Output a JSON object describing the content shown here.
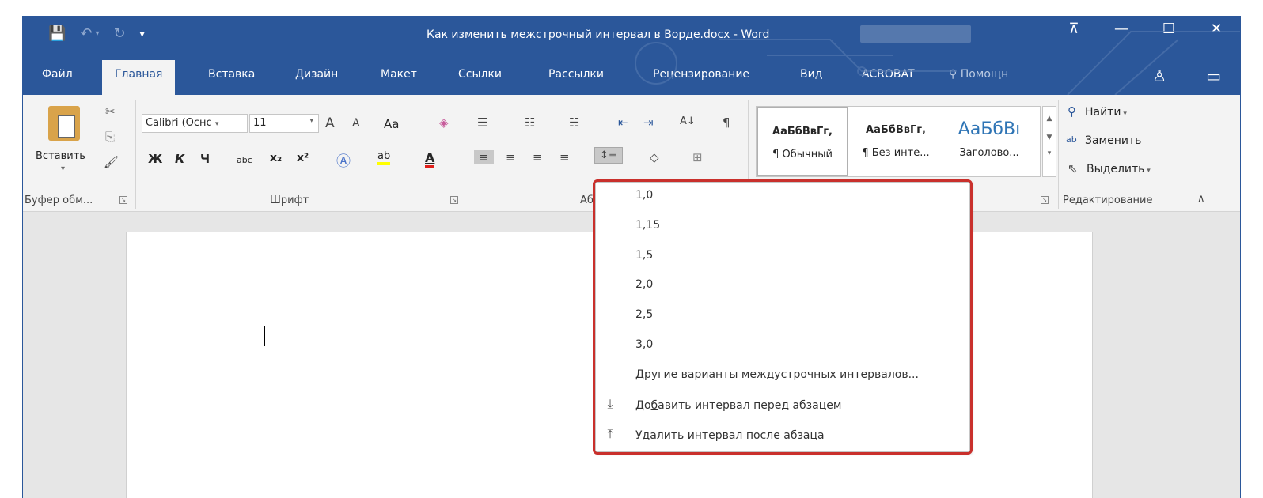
{
  "titlebar": {
    "title": "Как изменить межстрочный интервал в Ворде.docx - Word",
    "save_icon": "💾",
    "undo_icon": "↶",
    "undo_arrow": "▾",
    "redo_icon": "↻",
    "qat_more": "▾",
    "ribbon_display": "⊼",
    "minimize": "—",
    "maximize": "☐",
    "close": "✕"
  },
  "tabs": {
    "file": "Файл",
    "home": "Главная",
    "insert": "Вставка",
    "design": "Дизайн",
    "layout": "Макет",
    "references": "Ссылки",
    "mailings": "Рассылки",
    "review": "Рецензирование",
    "view": "Вид",
    "acrobat": "ACROBAT",
    "help": "♀ Помощн",
    "share_icon": "♙",
    "comment_icon": "▭"
  },
  "clipboard": {
    "paste": "Вставить",
    "paste_arrow": "▾",
    "cut_icon": "✂",
    "copy_icon": "⎘",
    "format_painter_icon": "🖌",
    "label": "Буфер обм..."
  },
  "font": {
    "font_name": "Calibri (Оснс",
    "font_size": "11",
    "grow": "A",
    "shrink": "A",
    "change_case": "Aa",
    "clear_formatting_icon": "◈",
    "bold": "Ж",
    "italic": "К",
    "underline": "Ч",
    "strikethrough": "abc",
    "subscript": "x₂",
    "superscript": "x²",
    "text_effects": "Ⓐ",
    "highlight": "ab",
    "font_color": "A",
    "label": "Шрифт"
  },
  "paragraph": {
    "label": "Аб",
    "bullets_icon": "☰",
    "numbering_icon": "☷",
    "multilevel_icon": "☵",
    "decrease_indent_icon": "⇤",
    "increase_indent_icon": "⇥",
    "sort_icon": "A↓",
    "show_marks_icon": "¶",
    "align_left_icon": "≡",
    "align_center_icon": "≡",
    "align_right_icon": "≡",
    "justify_icon": "≡",
    "line_spacing_icon": "↕≡",
    "shading_icon": "◇",
    "borders_icon": "⊞"
  },
  "styles": {
    "items": [
      {
        "sample": "АаБбВвГг,",
        "name": "¶ Обычный"
      },
      {
        "sample": "АаБбВвГг,",
        "name": "¶ Без инте..."
      },
      {
        "sample": "АаБбВı",
        "name": "Заголово..."
      }
    ]
  },
  "editing": {
    "find": "Найти",
    "replace": "Заменить",
    "select": "Выделить",
    "label": "Редактирование",
    "find_icon": "⚲",
    "replace_icon": "ab",
    "select_icon": "⇖",
    "collapse_icon": "∧"
  },
  "line_spacing_menu": {
    "options": [
      "1,0",
      "1,15",
      "1,5",
      "2,0",
      "2,5",
      "3,0"
    ],
    "more": "Другие варианты междустрочных интервалов...",
    "add_before_prefix": "До",
    "add_before_underlined": "б",
    "add_before_suffix": "авить интервал перед абзацем",
    "remove_after_underlined": "У",
    "remove_after_suffix": "далить интервал после абзаца",
    "add_before_icon": "⤓",
    "remove_after_icon": "⤒"
  },
  "colors": {
    "word_blue": "#2b579a",
    "highlight_red": "#c9302c"
  }
}
